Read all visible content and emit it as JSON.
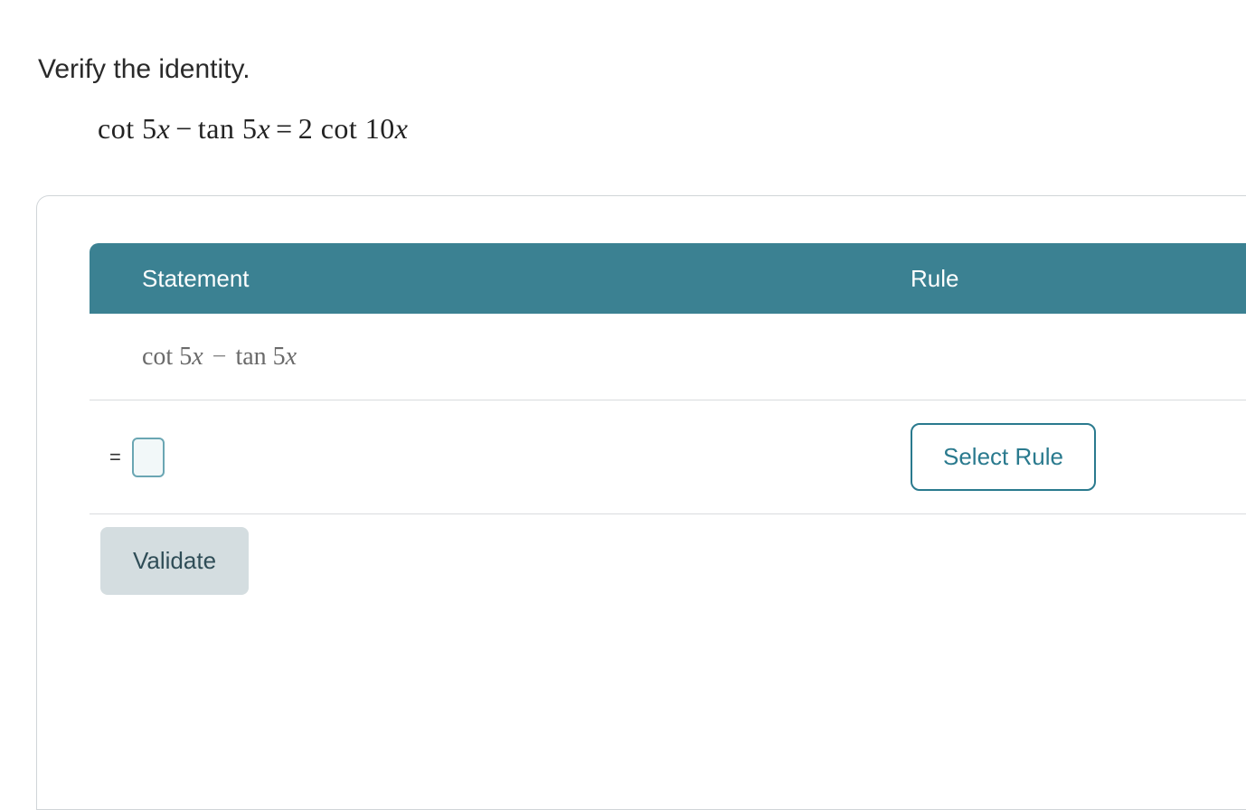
{
  "instruction": "Verify the identity.",
  "identity_equation": "cot 5x − tan 5x = 2 cot 10x",
  "table": {
    "headers": {
      "statement": "Statement",
      "rule": "Rule"
    },
    "rows": [
      {
        "statement": "cot 5x − tan 5x",
        "rule": ""
      },
      {
        "prefix": "=",
        "statement": "",
        "rule_button": "Select Rule"
      }
    ]
  },
  "buttons": {
    "validate": "Validate",
    "select_rule": "Select Rule"
  }
}
